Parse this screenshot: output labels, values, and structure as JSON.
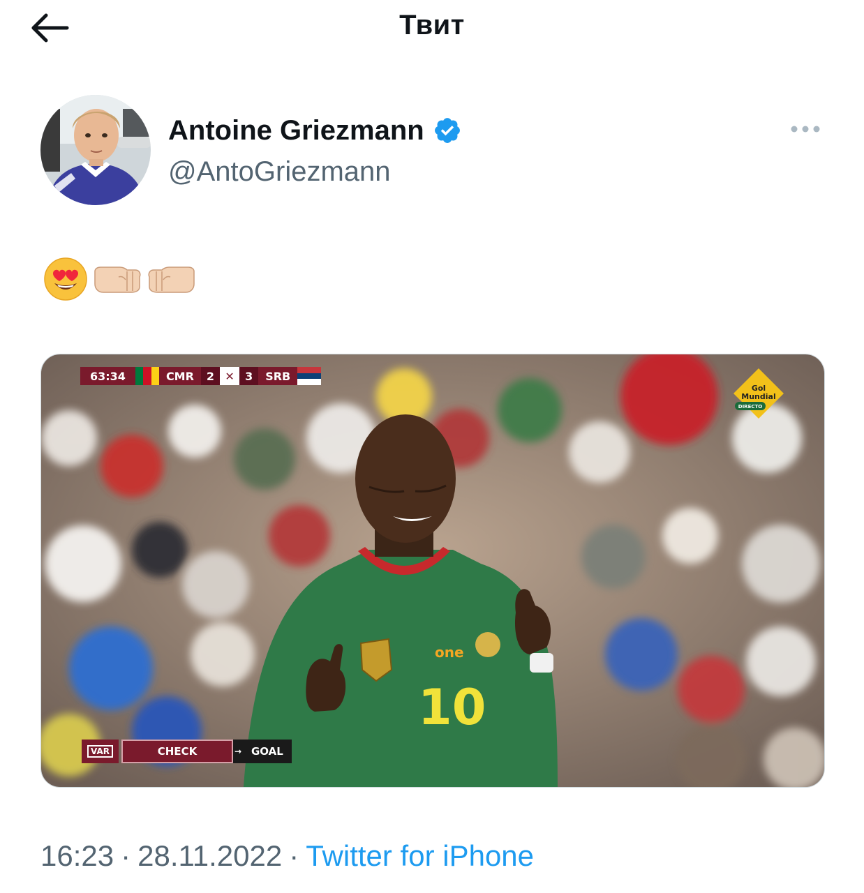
{
  "header": {
    "title": "Твит",
    "back_icon": "arrow-left-icon"
  },
  "author": {
    "display_name": "Antoine Griezmann",
    "handle": "@AntoGriezmann",
    "verified": true,
    "verified_color": "#1d9bf0"
  },
  "tweet": {
    "emojis": [
      "smiling-face-with-heart-eyes",
      "right-facing-fist",
      "left-facing-fist"
    ]
  },
  "media": {
    "scoreboard": {
      "clock": "63:34",
      "home_team": "CMR",
      "home_score": "2",
      "away_score": "3",
      "away_team": "SRB"
    },
    "var": {
      "tag": "VAR",
      "status": "CHECK",
      "decision": "GOAL"
    },
    "channel_logo": {
      "line1": "Gol",
      "line2": "Mundial",
      "badge": "DIRECTO"
    },
    "player_number": "10",
    "sponsor": "one"
  },
  "meta": {
    "time": "16:23",
    "separator": "·",
    "date": "28.11.2022",
    "source": "Twitter for iPhone"
  },
  "colors": {
    "text_primary": "#0f1419",
    "text_secondary": "#536471",
    "link": "#1d9bf0",
    "broadcast_maroon": "#7a1a2c"
  }
}
